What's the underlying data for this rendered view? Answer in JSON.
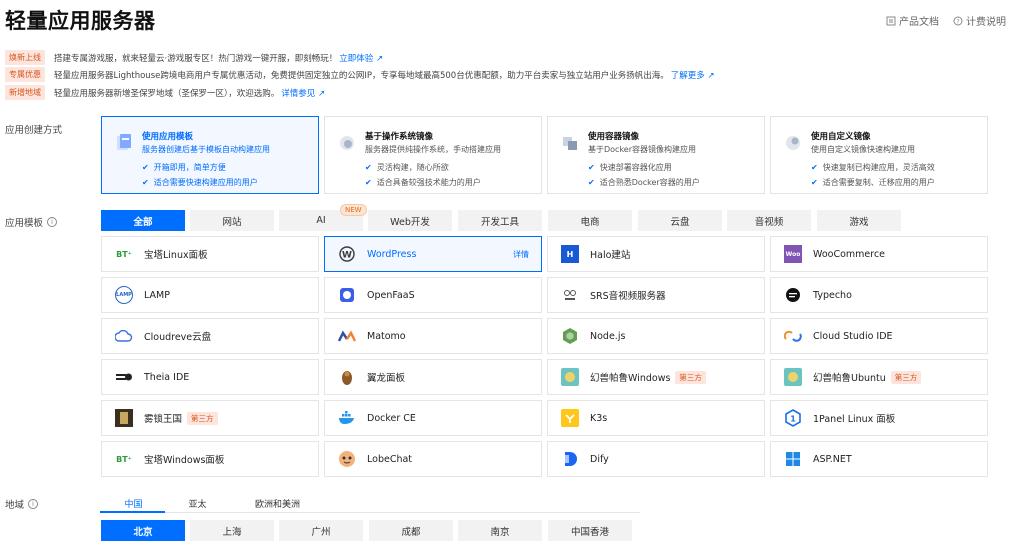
{
  "header": {
    "title": "轻量应用服务器",
    "docs_label": "产品文档",
    "billing_label": "计费说明"
  },
  "notices": [
    {
      "badge": "焕新上线",
      "text": "搭建专属游戏服，就来轻量云·游戏服专区！热门游戏一键开服，即刻畅玩！",
      "link": "立即体验"
    },
    {
      "badge": "专属优惠",
      "text": "轻量应用服务器Lighthouse跨境电商用户专属优惠活动，免费提供固定独立的公网IP，专享每地域最高500台优惠配额，助力平台卖家与独立站用户业务扬帆出海。",
      "link": "了解更多"
    },
    {
      "badge": "新增地域",
      "text": "轻量应用服务器新增圣保罗地域（圣保罗一区），欢迎选购。",
      "link": "详情参见"
    }
  ],
  "creation": {
    "label": "应用创建方式",
    "methods": [
      {
        "title": "使用应用模板",
        "subtitle": "服务器创建后基于模板自动构建应用",
        "features": [
          "开箱即用，简单方便",
          "适合需要快速构建应用的用户"
        ]
      },
      {
        "title": "基于操作系统镜像",
        "subtitle": "服务器提供纯操作系统，手动搭建应用",
        "features": [
          "灵活构建，随心所欲",
          "适合具备较强技术能力的用户"
        ]
      },
      {
        "title": "使用容器镜像",
        "subtitle": "基于Docker容器镜像构建应用",
        "features": [
          "快速部署容器化应用",
          "适合熟悉Docker容器的用户"
        ]
      },
      {
        "title": "使用自定义镜像",
        "subtitle": "使用自定义镜像快速构建应用",
        "features": [
          "快速复制已构建应用，灵活高效",
          "适合需要复制、迁移应用的用户"
        ]
      }
    ]
  },
  "templates": {
    "label": "应用模板",
    "new_tag": "NEW",
    "categories": [
      "全部",
      "网站",
      "AI",
      "Web开发",
      "开发工具",
      "电商",
      "云盘",
      "音视频",
      "游戏"
    ],
    "detail_label": "详情",
    "third_party_label": "第三方",
    "apps": [
      {
        "name": "宝塔Linux面板",
        "icon": "bt-icon",
        "logo": "BT⁺"
      },
      {
        "name": "WordPress",
        "icon": "wordpress-icon"
      },
      {
        "name": "Halo建站",
        "icon": "halo-icon",
        "logo": "H"
      },
      {
        "name": "WooCommerce",
        "icon": "woocommerce-icon",
        "logo": "Woo"
      },
      {
        "name": "LAMP",
        "icon": "lamp-icon",
        "logo": "LAMP"
      },
      {
        "name": "OpenFaaS",
        "icon": "openfaas-icon"
      },
      {
        "name": "SRS音视频服务器",
        "icon": "srs-icon"
      },
      {
        "name": "Typecho",
        "icon": "typecho-icon"
      },
      {
        "name": "Cloudreve云盘",
        "icon": "cloudreve-icon"
      },
      {
        "name": "Matomo",
        "icon": "matomo-icon"
      },
      {
        "name": "Node.js",
        "icon": "nodejs-icon"
      },
      {
        "name": "Cloud Studio IDE",
        "icon": "cloudstudio-icon"
      },
      {
        "name": "Theia IDE",
        "icon": "theia-icon"
      },
      {
        "name": "翼龙面板",
        "icon": "pterodactyl-icon"
      },
      {
        "name": "幻兽帕鲁Windows",
        "icon": "palworld-icon"
      },
      {
        "name": "幻兽帕鲁Ubuntu",
        "icon": "palworld-icon"
      },
      {
        "name": "雾锁王国",
        "icon": "enshrouded-icon"
      },
      {
        "name": "Docker CE",
        "icon": "docker-icon"
      },
      {
        "name": "K3s",
        "icon": "k3s-icon"
      },
      {
        "name": "1Panel Linux 面板",
        "icon": "1panel-icon"
      },
      {
        "name": "宝塔Windows面板",
        "icon": "bt-icon",
        "logo": "BT⁺"
      },
      {
        "name": "LobeChat",
        "icon": "lobechat-icon"
      },
      {
        "name": "Dify",
        "icon": "dify-icon"
      },
      {
        "name": "ASP.NET",
        "icon": "windows-icon"
      }
    ]
  },
  "region": {
    "label": "地域",
    "areas": [
      "中国",
      "亚太",
      "欧洲和美洲"
    ],
    "cities": [
      "北京",
      "上海",
      "广州",
      "成都",
      "南京",
      "中国香港"
    ]
  },
  "colors": {
    "accent": "#006eff",
    "badge_bg": "#fde5dd",
    "badge_text": "#d9541f"
  }
}
